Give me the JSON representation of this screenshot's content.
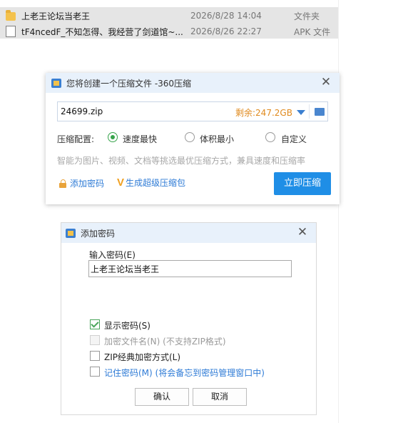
{
  "files": [
    {
      "name": "上老王论坛当老王",
      "date": "2026/8/28 14:04",
      "type": "文件夹",
      "icon": "folder-icon"
    },
    {
      "name": "tF4ncedF_不知怎得、我经营了剑道馆~...",
      "date": "2026/8/26 22:27",
      "type": "APK 文件",
      "icon": "file-icon"
    }
  ],
  "compress_dialog": {
    "title": "您将创建一个压缩文件 -360压缩",
    "path": "24699.zip",
    "free_space": "剩余:247.2GB",
    "config_label": "压缩配置:",
    "options": [
      {
        "label": "速度最快",
        "selected": true
      },
      {
        "label": "体积最小",
        "selected": false
      },
      {
        "label": "自定义",
        "selected": false
      }
    ],
    "hint": "智能为图片、视频、文档等挑选最优压缩方式，兼具速度和压缩率",
    "add_password": "添加密码",
    "super_zip": "生成超级压缩包",
    "compress_button": "立即压缩"
  },
  "password_dialog": {
    "title": "添加密码",
    "input_label": "输入密码(E)",
    "password_value": "上老王论坛当老王",
    "checks": [
      {
        "label": "显示密码(S)",
        "checked": true,
        "disabled": false
      },
      {
        "label": "加密文件名(N) (不支持ZIP格式)",
        "checked": false,
        "disabled": true
      },
      {
        "label": "ZIP经典加密方式(L)",
        "checked": false,
        "disabled": false
      },
      {
        "label": "记住密码(M) (将会备忘到密码管理窗口中)",
        "checked": false,
        "disabled": false
      }
    ],
    "ok_button": "确认",
    "cancel_button": "取消"
  },
  "colors": {
    "accent": "#1f8ee6",
    "space": "#e08a1e",
    "radio_on": "#36a34a",
    "title_bar": "#e8f1fb"
  }
}
